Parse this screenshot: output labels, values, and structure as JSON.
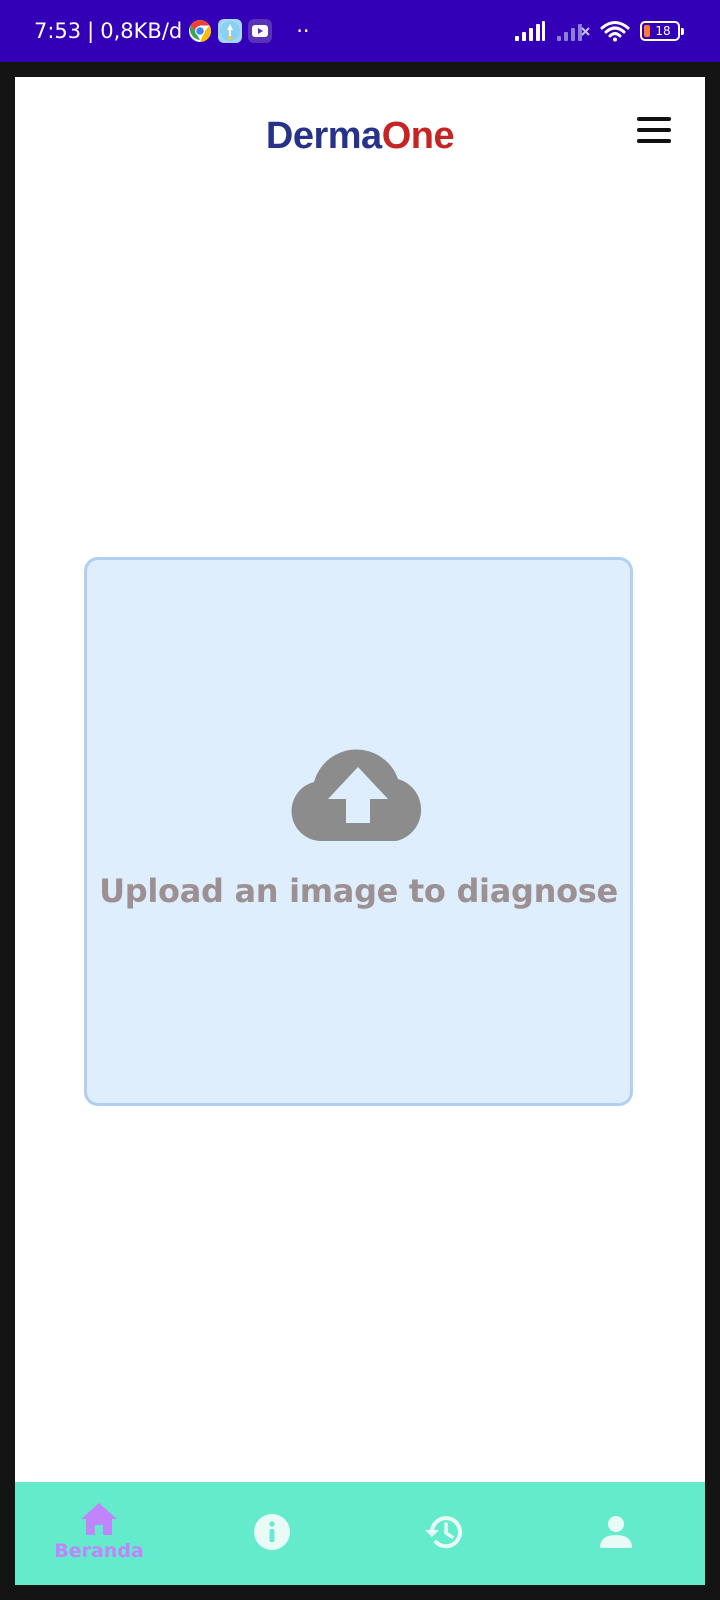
{
  "status_bar": {
    "time": "7:53",
    "separator": "|",
    "data_rate": "0,8KB/d",
    "overflow_dots": "··",
    "battery_level": "18",
    "notification_icons": [
      "chrome-icon",
      "linktree-icon",
      "youtube-icon"
    ],
    "system_icons": [
      "signal-icon",
      "signal-no-service-icon",
      "wifi-icon",
      "battery-icon"
    ]
  },
  "app": {
    "logo_part1": "Derma",
    "logo_part2": "One",
    "menu_icon": "hamburger-menu-icon"
  },
  "upload": {
    "icon": "cloud-upload-icon",
    "text": "Upload an image to diagnose"
  },
  "bottom_nav": {
    "items": [
      {
        "icon": "home-icon",
        "label": "Beranda",
        "active": true
      },
      {
        "icon": "info-icon",
        "label": "",
        "active": false
      },
      {
        "icon": "history-icon",
        "label": "",
        "active": false
      },
      {
        "icon": "profile-icon",
        "label": "",
        "active": false
      }
    ]
  },
  "colors": {
    "status_bar_bg": "#3300b8",
    "logo_derma": "#27328a",
    "logo_one": "#c62323",
    "upload_bg": "#deeefd",
    "upload_border": "#b0cff3",
    "upload_icon": "#8c8c8c",
    "upload_text": "#9c9092",
    "nav_bg": "#64ebcb",
    "nav_active": "#c084fc",
    "nav_inactive": "#e8fbf6"
  }
}
